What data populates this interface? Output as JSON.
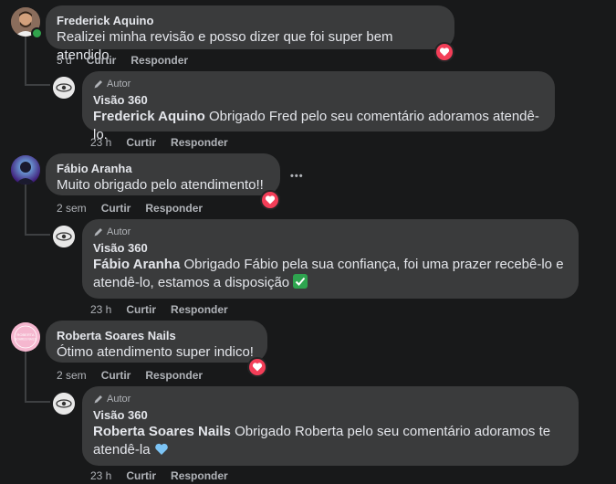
{
  "comments": [
    {
      "author": "Frederick Aquino",
      "text": "Realizei minha revisão e posso dizer que foi super bem atendido",
      "time": "5 d",
      "like": "Curtir",
      "reply": "Responder",
      "reaction": "heart",
      "online": true,
      "response": {
        "badge": "Autor",
        "author": "Visão 360",
        "mention": "Frederick Aquino",
        "text": " Obrigado Fred pelo seu comentário adoramos atendê-lo.",
        "time": "23 h",
        "like": "Curtir",
        "reply": "Responder"
      }
    },
    {
      "author": "Fábio Aranha",
      "text": "Muito obrigado pelo atendimento!!",
      "time": "2 sem",
      "like": "Curtir",
      "reply": "Responder",
      "reaction": "heart",
      "more": "•••",
      "response": {
        "badge": "Autor",
        "author": "Visão 360",
        "mention": "Fábio Aranha",
        "text": " Obrigado Fábio pela sua confiança, foi uma prazer recebê-lo e atendê-lo, estamos a disposição ",
        "emoji": "check-mark-emoji",
        "time": "23 h",
        "like": "Curtir",
        "reply": "Responder"
      }
    },
    {
      "author": "Roberta Soares Nails",
      "avatar_text": "ROBERTA SOARES NAILS",
      "text": "Ótimo atendimento super indico!",
      "time": "2 sem",
      "like": "Curtir",
      "reply": "Responder",
      "reaction": "heart",
      "response": {
        "badge": "Autor",
        "author": "Visão 360",
        "mention": "Roberta Soares Nails",
        "text": " Obrigado Roberta pelo seu comentário adoramos te atendê-la ",
        "emoji": "blue-heart-emoji",
        "time": "23 h",
        "like": "Curtir",
        "reply": "Responder"
      }
    }
  ],
  "colors": {
    "background": "#18191a",
    "bubble": "#3a3b3c",
    "text": "#e4e6eb",
    "secondary": "#b0b3b8",
    "reaction": "#f33e58",
    "online": "#31a24c"
  }
}
